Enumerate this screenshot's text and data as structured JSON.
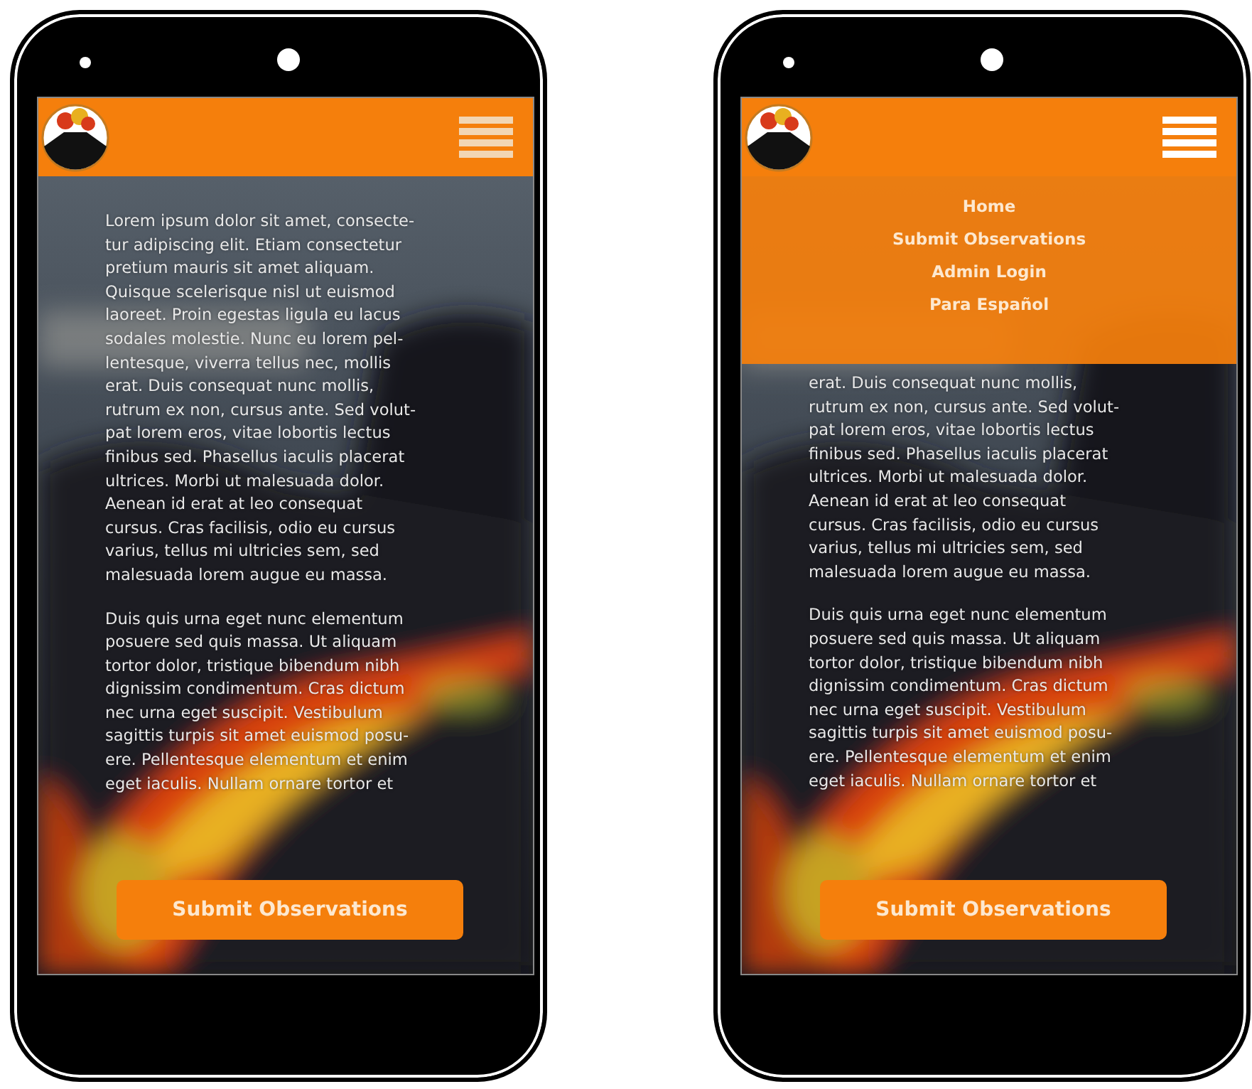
{
  "phones": [
    {
      "menu": {
        "expanded": false
      },
      "paragraphs": [
        [
          "Lorem ipsum dolor sit amet, consecte-",
          "tur adipiscing elit. Etiam consectetur",
          "pretium mauris sit amet aliquam.",
          "Quisque scelerisque nisl ut euismod",
          "laoreet. Proin egestas ligula eu lacus",
          "sodales molestie. Nunc eu lorem pel-",
          "lentesque, viverra tellus nec, mollis",
          "erat. Duis consequat nunc mollis,",
          "rutrum ex non, cursus ante. Sed volut-",
          "pat lorem eros, vitae lobortis lectus",
          "finibus sed. Phasellus iaculis placerat",
          "ultrices. Morbi ut malesuada dolor.",
          "Aenean id erat at leo consequat",
          "cursus. Cras facilisis, odio eu cursus",
          "varius, tellus mi ultricies sem, sed",
          "malesuada lorem augue eu massa."
        ],
        [
          "Duis quis urna eget nunc elementum",
          "posuere sed quis massa. Ut aliquam",
          "tortor dolor, tristique bibendum nibh",
          "dignissim condimentum. Cras dictum",
          "nec urna eget suscipit. Vestibulum",
          "sagittis turpis sit amet euismod posu-",
          "ere. Pellentesque elementum et enim",
          "eget iaculis. Nullam ornare tortor et"
        ]
      ],
      "button": "Submit Observations"
    },
    {
      "menu": {
        "expanded": true,
        "items": [
          "Home",
          "Submit Observations",
          "Admin Login",
          "Para Español"
        ]
      },
      "paragraphs": [
        [
          "erat. Duis consequat nunc mollis,",
          "rutrum ex non, cursus ante. Sed volut-",
          "pat lorem eros, vitae lobortis lectus",
          "finibus sed. Phasellus iaculis placerat",
          "ultrices. Morbi ut malesuada dolor.",
          "Aenean id erat at leo consequat",
          "cursus. Cras facilisis, odio eu cursus",
          "varius, tellus mi ultricies sem, sed",
          "malesuada lorem augue eu massa."
        ],
        [
          "Duis quis urna eget nunc elementum",
          "posuere sed quis massa. Ut aliquam",
          "tortor dolor, tristique bibendum nibh",
          "dignissim condimentum. Cras dictum",
          "nec urna eget suscipit. Vestibulum",
          "sagittis turpis sit amet euismod posu-",
          "ere. Pellentesque elementum et enim",
          "eget iaculis. Nullam ornare tortor et"
        ]
      ],
      "button": "Submit Observations"
    }
  ]
}
